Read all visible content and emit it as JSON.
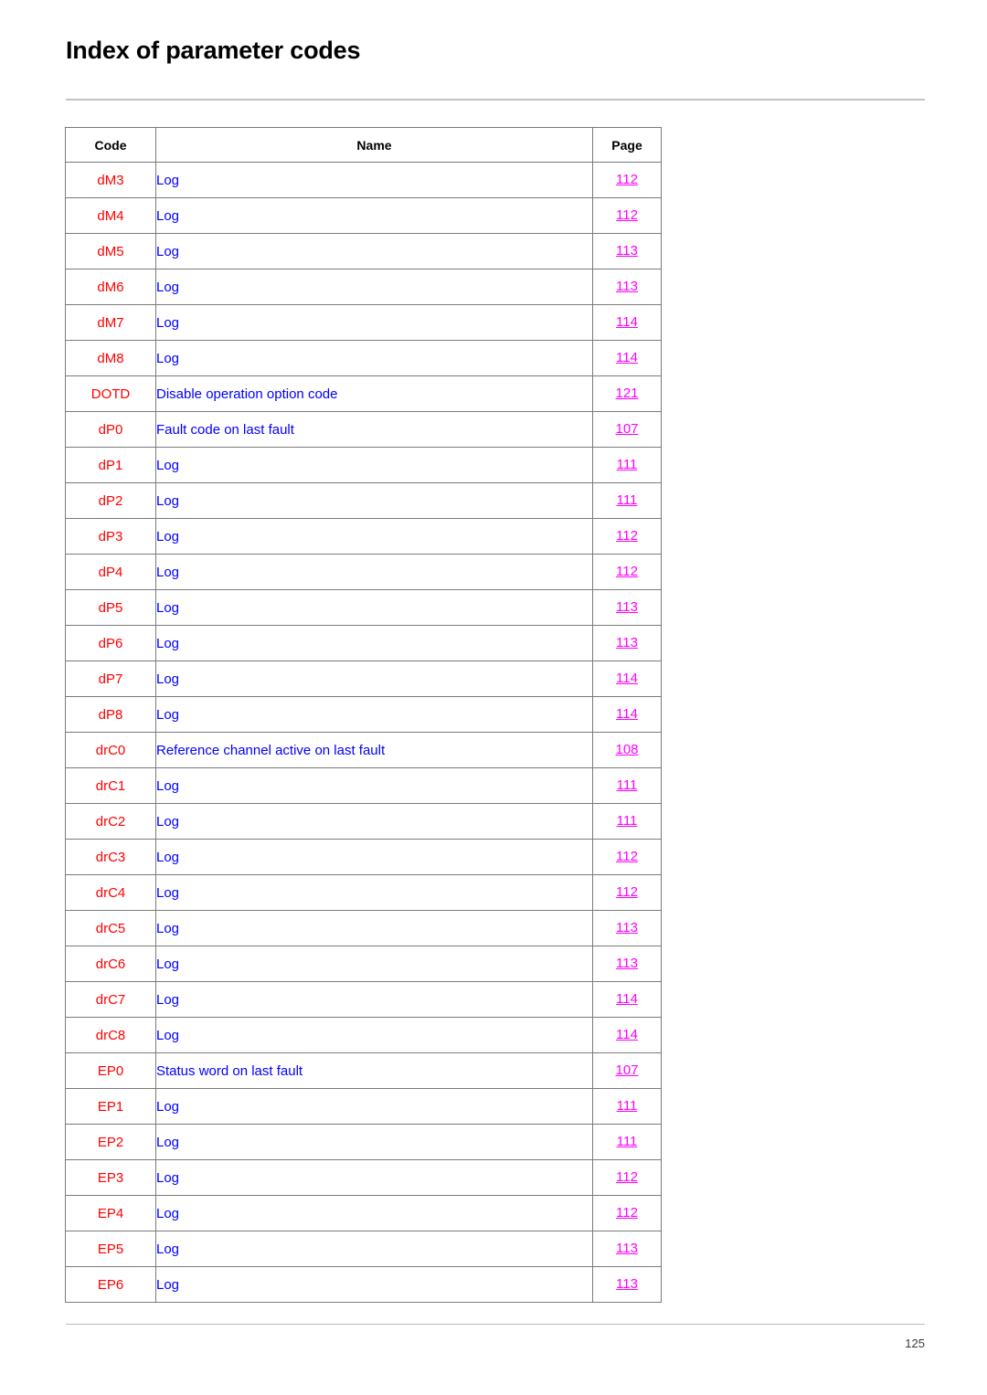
{
  "document": {
    "title": "Index of parameter codes",
    "footer_page_number": "125"
  },
  "colors": {
    "code_text": "#ff0000",
    "name_text": "#0000ff",
    "page_link": "#ff00ff",
    "border": "#7b7b7b",
    "rule": "#c3c3c3"
  },
  "table": {
    "columns": [
      {
        "key": "code",
        "label": "Code"
      },
      {
        "key": "name",
        "label": "Name"
      },
      {
        "key": "page",
        "label": "Page"
      }
    ],
    "rows": [
      {
        "code": "dM3",
        "name": "Log",
        "page": "112"
      },
      {
        "code": "dM4",
        "name": "Log",
        "page": "112"
      },
      {
        "code": "dM5",
        "name": "Log",
        "page": "113"
      },
      {
        "code": "dM6",
        "name": "Log",
        "page": "113"
      },
      {
        "code": "dM7",
        "name": "Log",
        "page": "114"
      },
      {
        "code": "dM8",
        "name": "Log",
        "page": "114"
      },
      {
        "code": "DOTD",
        "name": "Disable operation option code",
        "page": "121"
      },
      {
        "code": "dP0",
        "name": "Fault code on last fault",
        "page": "107"
      },
      {
        "code": "dP1",
        "name": "Log",
        "page": "111"
      },
      {
        "code": "dP2",
        "name": "Log",
        "page": "111"
      },
      {
        "code": "dP3",
        "name": "Log",
        "page": "112"
      },
      {
        "code": "dP4",
        "name": "Log",
        "page": "112"
      },
      {
        "code": "dP5",
        "name": "Log",
        "page": "113"
      },
      {
        "code": "dP6",
        "name": "Log",
        "page": "113"
      },
      {
        "code": "dP7",
        "name": "Log",
        "page": "114"
      },
      {
        "code": "dP8",
        "name": "Log",
        "page": "114"
      },
      {
        "code": "drC0",
        "name": "Reference channel active on last fault",
        "page": "108"
      },
      {
        "code": "drC1",
        "name": "Log",
        "page": "111"
      },
      {
        "code": "drC2",
        "name": "Log",
        "page": "111"
      },
      {
        "code": "drC3",
        "name": "Log",
        "page": "112"
      },
      {
        "code": "drC4",
        "name": "Log",
        "page": "112"
      },
      {
        "code": "drC5",
        "name": "Log",
        "page": "113"
      },
      {
        "code": "drC6",
        "name": "Log",
        "page": "113"
      },
      {
        "code": "drC7",
        "name": "Log",
        "page": "114"
      },
      {
        "code": "drC8",
        "name": "Log",
        "page": "114"
      },
      {
        "code": "EP0",
        "name": "Status word on last fault",
        "page": "107"
      },
      {
        "code": "EP1",
        "name": "Log",
        "page": "111"
      },
      {
        "code": "EP2",
        "name": "Log",
        "page": "111"
      },
      {
        "code": "EP3",
        "name": "Log",
        "page": "112"
      },
      {
        "code": "EP4",
        "name": "Log",
        "page": "112"
      },
      {
        "code": "EP5",
        "name": "Log",
        "page": "113"
      },
      {
        "code": "EP6",
        "name": "Log",
        "page": "113"
      }
    ]
  }
}
